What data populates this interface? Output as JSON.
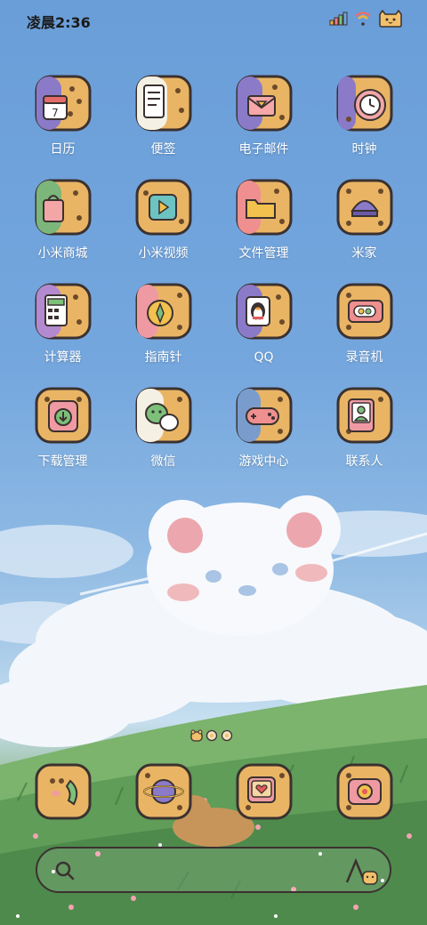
{
  "status_bar": {
    "time": "凌晨2:36",
    "icons": [
      "signal-icon",
      "wifi-icon",
      "battery-icon"
    ]
  },
  "apps": [
    {
      "label": "日历",
      "icon": "calendar-icon",
      "calendar_day": "7"
    },
    {
      "label": "便签",
      "icon": "notes-icon"
    },
    {
      "label": "电子邮件",
      "icon": "email-icon"
    },
    {
      "label": "时钟",
      "icon": "clock-icon"
    },
    {
      "label": "小米商城",
      "icon": "shopping-bag-icon"
    },
    {
      "label": "小米视频",
      "icon": "video-play-icon"
    },
    {
      "label": "文件管理",
      "icon": "folder-icon"
    },
    {
      "label": "米家",
      "icon": "smart-home-icon"
    },
    {
      "label": "计算器",
      "icon": "calculator-icon"
    },
    {
      "label": "指南针",
      "icon": "compass-icon"
    },
    {
      "label": "QQ",
      "icon": "penguin-icon"
    },
    {
      "label": "录音机",
      "icon": "recorder-icon"
    },
    {
      "label": "下载管理",
      "icon": "download-icon"
    },
    {
      "label": "微信",
      "icon": "chat-bubbles-icon"
    },
    {
      "label": "游戏中心",
      "icon": "gamepad-icon"
    },
    {
      "label": "联系人",
      "icon": "contact-icon"
    }
  ],
  "dock": [
    {
      "icon": "phone-icon"
    },
    {
      "icon": "planet-browser-icon"
    },
    {
      "icon": "message-heart-icon"
    },
    {
      "icon": "flower-camera-icon"
    }
  ],
  "search": {
    "left_icon": "search-icon",
    "right_icon": "voice-assistant-icon"
  },
  "colors": {
    "sky": "#6a9ed8",
    "cookie": "#e9b565",
    "outline": "#3b3130",
    "label": "#ffffff",
    "time_text": "#1a1a1a"
  }
}
